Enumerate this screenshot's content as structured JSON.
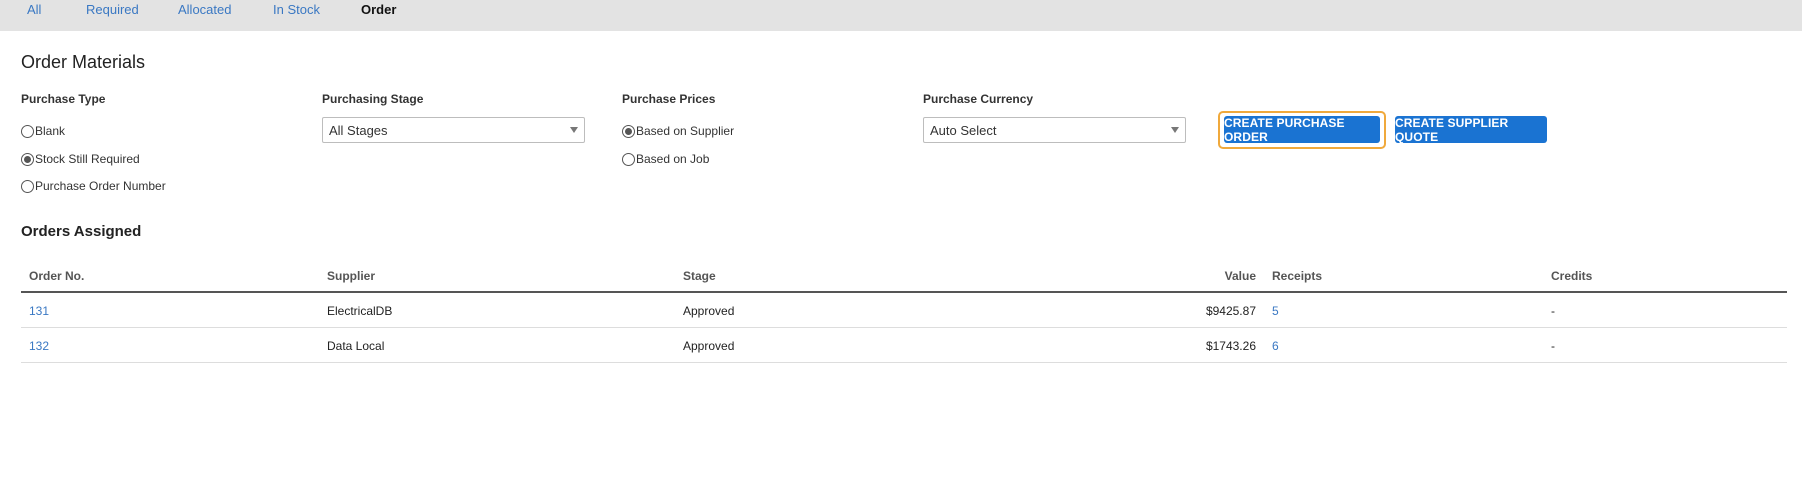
{
  "tabs": {
    "all": "All",
    "required": "Required",
    "allocated": "Allocated",
    "in_stock": "In Stock",
    "order": "Order"
  },
  "page_title": "Order Materials",
  "purchase_type": {
    "label": "Purchase Type",
    "options": [
      "Blank",
      "Stock Still Required",
      "Purchase Order Number"
    ],
    "selected": "Stock Still Required"
  },
  "purchasing_stage": {
    "label": "Purchasing Stage",
    "value": "All Stages"
  },
  "purchase_prices": {
    "label": "Purchase Prices",
    "options": [
      "Based on Supplier",
      "Based on Job"
    ],
    "selected": "Based on Supplier"
  },
  "purchase_currency": {
    "label": "Purchase Currency",
    "value": "Auto Select"
  },
  "buttons": {
    "create_po": "CREATE PURCHASE ORDER",
    "create_quote": "CREATE SUPPLIER QUOTE"
  },
  "orders": {
    "title": "Orders Assigned",
    "headers": {
      "order_no": "Order No.",
      "supplier": "Supplier",
      "stage": "Stage",
      "value": "Value",
      "receipts": "Receipts",
      "credits": "Credits"
    },
    "rows": [
      {
        "order_no": "131",
        "supplier": "ElectricalDB",
        "stage": "Approved",
        "value": "$9425.87",
        "receipts": "5",
        "credits": "-"
      },
      {
        "order_no": "132",
        "supplier": "Data Local",
        "stage": "Approved",
        "value": "$1743.26",
        "receipts": "6",
        "credits": "-"
      }
    ]
  },
  "colors": {
    "accent": "#1a73d2",
    "link": "#3a78c3",
    "focus_ring": "#f0a93c",
    "tabbar_bg": "#e3e3e3"
  }
}
